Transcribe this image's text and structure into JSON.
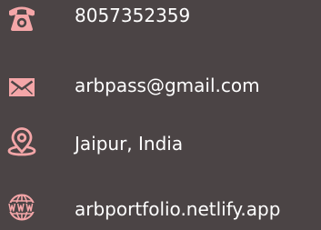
{
  "contacts": {
    "phone": {
      "icon": "phone-icon",
      "text": "8057352359"
    },
    "email": {
      "icon": "envelope-icon",
      "text": "arbpass@gmail.com"
    },
    "address": {
      "icon": "location-pin-icon",
      "text": "Jaipur, India"
    },
    "website": {
      "icon": "globe-www-icon",
      "text": "arbportfolio.netlify.app"
    }
  },
  "colors": {
    "background": "#4b4445",
    "icon_accent": "#f4a6a8",
    "text": "#ffffff"
  }
}
